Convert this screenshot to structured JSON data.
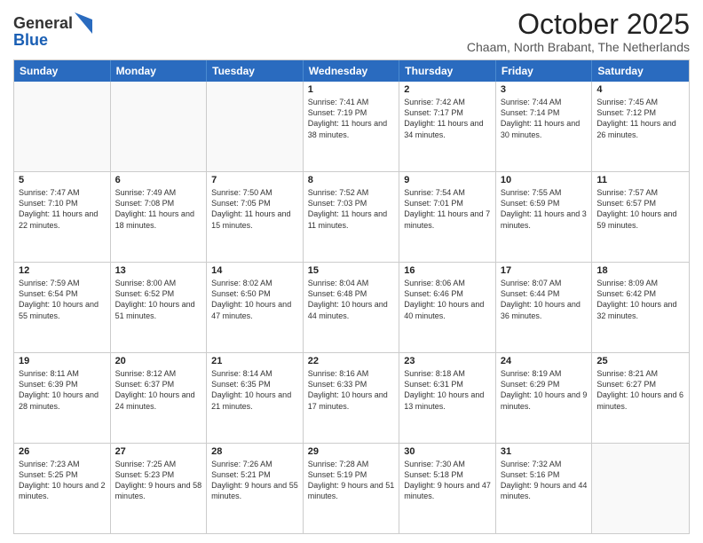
{
  "logo": {
    "general": "General",
    "blue": "Blue"
  },
  "header": {
    "month": "October 2025",
    "location": "Chaam, North Brabant, The Netherlands"
  },
  "days": [
    "Sunday",
    "Monday",
    "Tuesday",
    "Wednesday",
    "Thursday",
    "Friday",
    "Saturday"
  ],
  "weeks": [
    [
      {
        "day": "",
        "content": ""
      },
      {
        "day": "",
        "content": ""
      },
      {
        "day": "",
        "content": ""
      },
      {
        "day": "1",
        "content": "Sunrise: 7:41 AM\nSunset: 7:19 PM\nDaylight: 11 hours\nand 38 minutes."
      },
      {
        "day": "2",
        "content": "Sunrise: 7:42 AM\nSunset: 7:17 PM\nDaylight: 11 hours\nand 34 minutes."
      },
      {
        "day": "3",
        "content": "Sunrise: 7:44 AM\nSunset: 7:14 PM\nDaylight: 11 hours\nand 30 minutes."
      },
      {
        "day": "4",
        "content": "Sunrise: 7:45 AM\nSunset: 7:12 PM\nDaylight: 11 hours\nand 26 minutes."
      }
    ],
    [
      {
        "day": "5",
        "content": "Sunrise: 7:47 AM\nSunset: 7:10 PM\nDaylight: 11 hours\nand 22 minutes."
      },
      {
        "day": "6",
        "content": "Sunrise: 7:49 AM\nSunset: 7:08 PM\nDaylight: 11 hours\nand 18 minutes."
      },
      {
        "day": "7",
        "content": "Sunrise: 7:50 AM\nSunset: 7:05 PM\nDaylight: 11 hours\nand 15 minutes."
      },
      {
        "day": "8",
        "content": "Sunrise: 7:52 AM\nSunset: 7:03 PM\nDaylight: 11 hours\nand 11 minutes."
      },
      {
        "day": "9",
        "content": "Sunrise: 7:54 AM\nSunset: 7:01 PM\nDaylight: 11 hours\nand 7 minutes."
      },
      {
        "day": "10",
        "content": "Sunrise: 7:55 AM\nSunset: 6:59 PM\nDaylight: 11 hours\nand 3 minutes."
      },
      {
        "day": "11",
        "content": "Sunrise: 7:57 AM\nSunset: 6:57 PM\nDaylight: 10 hours\nand 59 minutes."
      }
    ],
    [
      {
        "day": "12",
        "content": "Sunrise: 7:59 AM\nSunset: 6:54 PM\nDaylight: 10 hours\nand 55 minutes."
      },
      {
        "day": "13",
        "content": "Sunrise: 8:00 AM\nSunset: 6:52 PM\nDaylight: 10 hours\nand 51 minutes."
      },
      {
        "day": "14",
        "content": "Sunrise: 8:02 AM\nSunset: 6:50 PM\nDaylight: 10 hours\nand 47 minutes."
      },
      {
        "day": "15",
        "content": "Sunrise: 8:04 AM\nSunset: 6:48 PM\nDaylight: 10 hours\nand 44 minutes."
      },
      {
        "day": "16",
        "content": "Sunrise: 8:06 AM\nSunset: 6:46 PM\nDaylight: 10 hours\nand 40 minutes."
      },
      {
        "day": "17",
        "content": "Sunrise: 8:07 AM\nSunset: 6:44 PM\nDaylight: 10 hours\nand 36 minutes."
      },
      {
        "day": "18",
        "content": "Sunrise: 8:09 AM\nSunset: 6:42 PM\nDaylight: 10 hours\nand 32 minutes."
      }
    ],
    [
      {
        "day": "19",
        "content": "Sunrise: 8:11 AM\nSunset: 6:39 PM\nDaylight: 10 hours\nand 28 minutes."
      },
      {
        "day": "20",
        "content": "Sunrise: 8:12 AM\nSunset: 6:37 PM\nDaylight: 10 hours\nand 24 minutes."
      },
      {
        "day": "21",
        "content": "Sunrise: 8:14 AM\nSunset: 6:35 PM\nDaylight: 10 hours\nand 21 minutes."
      },
      {
        "day": "22",
        "content": "Sunrise: 8:16 AM\nSunset: 6:33 PM\nDaylight: 10 hours\nand 17 minutes."
      },
      {
        "day": "23",
        "content": "Sunrise: 8:18 AM\nSunset: 6:31 PM\nDaylight: 10 hours\nand 13 minutes."
      },
      {
        "day": "24",
        "content": "Sunrise: 8:19 AM\nSunset: 6:29 PM\nDaylight: 10 hours\nand 9 minutes."
      },
      {
        "day": "25",
        "content": "Sunrise: 8:21 AM\nSunset: 6:27 PM\nDaylight: 10 hours\nand 6 minutes."
      }
    ],
    [
      {
        "day": "26",
        "content": "Sunrise: 7:23 AM\nSunset: 5:25 PM\nDaylight: 10 hours\nand 2 minutes."
      },
      {
        "day": "27",
        "content": "Sunrise: 7:25 AM\nSunset: 5:23 PM\nDaylight: 9 hours\nand 58 minutes."
      },
      {
        "day": "28",
        "content": "Sunrise: 7:26 AM\nSunset: 5:21 PM\nDaylight: 9 hours\nand 55 minutes."
      },
      {
        "day": "29",
        "content": "Sunrise: 7:28 AM\nSunset: 5:19 PM\nDaylight: 9 hours\nand 51 minutes."
      },
      {
        "day": "30",
        "content": "Sunrise: 7:30 AM\nSunset: 5:18 PM\nDaylight: 9 hours\nand 47 minutes."
      },
      {
        "day": "31",
        "content": "Sunrise: 7:32 AM\nSunset: 5:16 PM\nDaylight: 9 hours\nand 44 minutes."
      },
      {
        "day": "",
        "content": ""
      }
    ]
  ]
}
